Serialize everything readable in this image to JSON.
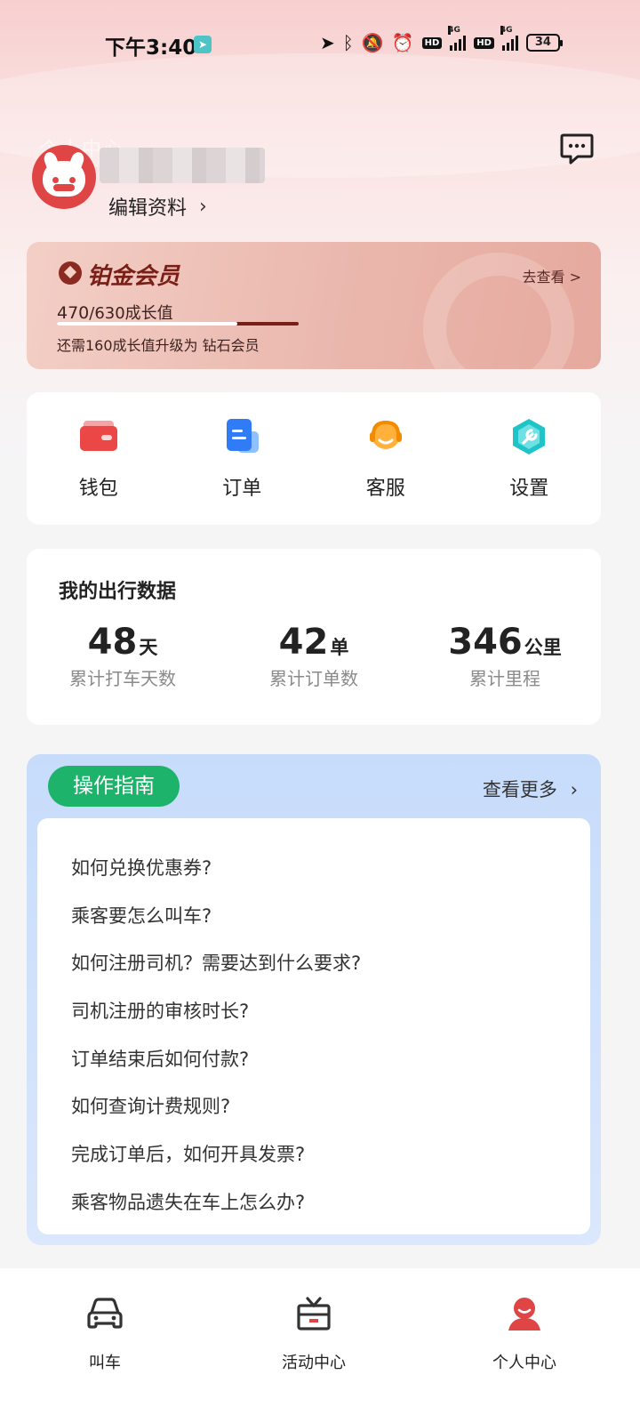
{
  "status_bar": {
    "time": "下午3:40",
    "network_1": "4G",
    "network_2": "4G",
    "battery": "34"
  },
  "profile": {
    "header_ghost": "个人中心",
    "edit_label": "编辑资料"
  },
  "membership": {
    "level": "铂金会员",
    "goto": "去查看 >",
    "points_current": "470",
    "points_total": "/630成长值",
    "progress": 0.746,
    "hint": "还需160成长值升级为 钻石会员"
  },
  "quick_actions": [
    {
      "label": "钱包",
      "icon": "wallet-icon"
    },
    {
      "label": "订单",
      "icon": "order-icon"
    },
    {
      "label": "客服",
      "icon": "customer-service-icon"
    },
    {
      "label": "设置",
      "icon": "settings-icon"
    }
  ],
  "travel": {
    "title": "我的出行数据",
    "stats": [
      {
        "value": "48",
        "unit": "天",
        "label": "累计打车天数"
      },
      {
        "value": "42",
        "unit": "单",
        "label": "累计订单数"
      },
      {
        "value": "346",
        "unit": "公里",
        "label": "累计里程"
      }
    ]
  },
  "guide": {
    "tag": "操作指南",
    "more": "查看更多",
    "items": [
      "如何兑换优惠券?",
      "乘客要怎么叫车?",
      "如何注册司机？需要达到什么要求?",
      "司机注册的审核时长?",
      "订单结束后如何付款?",
      "如何查询计费规则?",
      "完成订单后，如何开具发票?",
      "乘客物品遗失在车上怎么办?"
    ]
  },
  "bottom_nav": [
    {
      "label": "叫车",
      "icon": "car-icon"
    },
    {
      "label": "活动中心",
      "icon": "gift-icon"
    },
    {
      "label": "个人中心",
      "icon": "profile-icon"
    }
  ],
  "colors": {
    "brand_red": "#e04545",
    "member_dark": "#7a1f17",
    "guide_green": "#1db36a",
    "guide_blue_bg": "#c7dcfb"
  }
}
